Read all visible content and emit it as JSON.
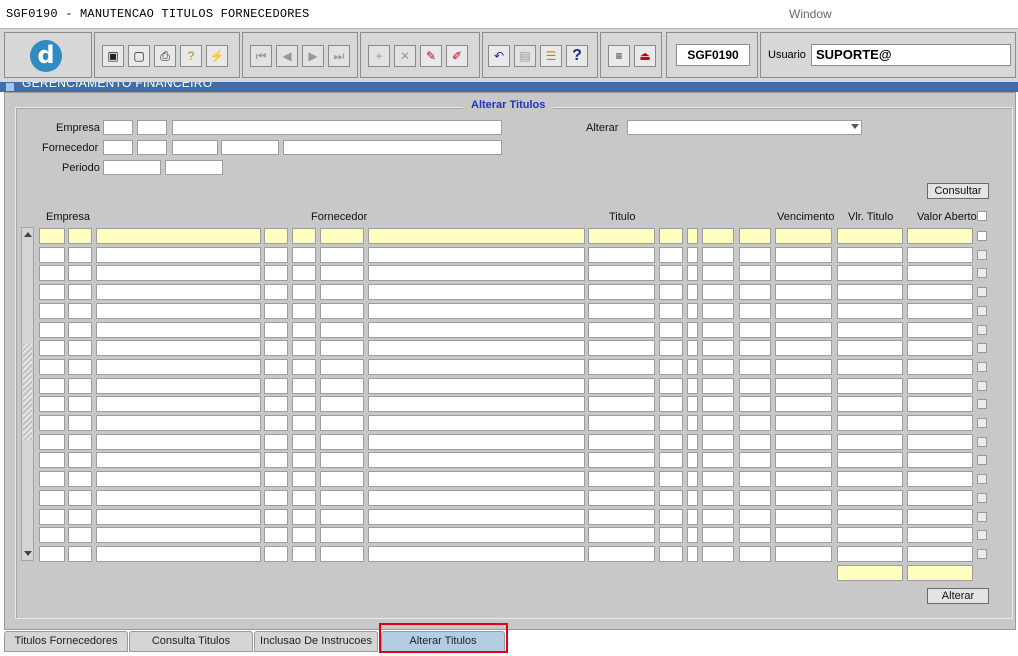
{
  "window": {
    "title": "SGF0190 - MANUTENCAO TITULOS FORNECEDORES",
    "menu": "Window"
  },
  "toolbar": {
    "logo_letter": "d",
    "buttons": [
      {
        "name": "save-icon",
        "glyph": "▣"
      },
      {
        "name": "window-icon",
        "glyph": "▢"
      },
      {
        "name": "print-icon",
        "glyph": "⎙"
      },
      {
        "name": "query-icon",
        "glyph": "?"
      },
      {
        "name": "execute-query-icon",
        "glyph": "⚡"
      },
      {
        "name": "first-record-icon",
        "glyph": "⏮"
      },
      {
        "name": "previous-record-icon",
        "glyph": "◀"
      },
      {
        "name": "next-record-icon",
        "glyph": "▶"
      },
      {
        "name": "last-record-icon",
        "glyph": "⏭"
      },
      {
        "name": "insert-record-icon",
        "glyph": "+"
      },
      {
        "name": "delete-record-icon",
        "glyph": "✕"
      },
      {
        "name": "edit-record-icon",
        "glyph": "✎"
      },
      {
        "name": "clear-icon",
        "glyph": "✐"
      },
      {
        "name": "undo-icon",
        "glyph": "↶"
      },
      {
        "name": "clipboard-icon",
        "glyph": "▤"
      },
      {
        "name": "list-of-values-icon",
        "glyph": "☰"
      },
      {
        "name": "help-icon",
        "glyph": "?"
      },
      {
        "name": "menu-icon",
        "glyph": "≡"
      },
      {
        "name": "exit-icon",
        "glyph": "⏏"
      }
    ],
    "form_code": "SGF0190",
    "user_label": "Usuario",
    "user_value": "SUPORTE@"
  },
  "module_strip": "GERENCIAMENTO FINANCEIRO",
  "form": {
    "title": "Alterar Titulos",
    "labels": {
      "empresa": "Empresa",
      "fornecedor": "Fornecedor",
      "periodo": "Periodo",
      "alterar": "Alterar"
    },
    "consultar_button": "Consultar",
    "alterar_button": "Alterar"
  },
  "grid": {
    "headers": [
      "Empresa",
      "Fornecedor",
      "Titulo",
      "Vencimento",
      "Vlr. Titulo",
      "Valor Aberto"
    ],
    "row_count": 18
  },
  "tabs": [
    {
      "label": "Titulos Fornecedores",
      "active": false
    },
    {
      "label": "Consulta Titulos",
      "active": false
    },
    {
      "label": "Inclusao De Instrucoes",
      "active": false
    },
    {
      "label": "Alterar Titulos",
      "active": true
    }
  ]
}
